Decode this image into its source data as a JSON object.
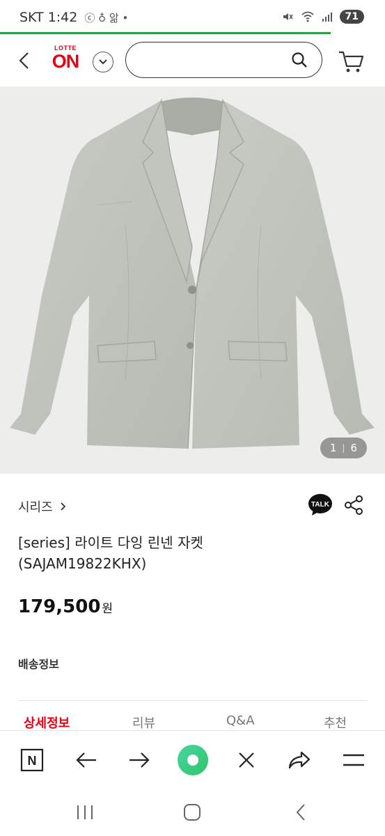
{
  "status_bar": {
    "carrier_time": "SKT 1:42",
    "extra_icons": "ⓒ ♁ 앎 •",
    "battery": "71"
  },
  "header": {
    "logo_top": "LOTTE",
    "logo_main": "ON",
    "search_placeholder": ""
  },
  "gallery": {
    "current": "1",
    "separator": "|",
    "total": "6"
  },
  "product": {
    "brand": "시리즈",
    "title": "[series] 라이트 다잉 린넨 자켓 (SAJAM19822KHX)",
    "price": "179,500",
    "currency": "원",
    "shipping_label": "배송정보"
  },
  "tabs": [
    {
      "label": "상세정보"
    },
    {
      "label": "리뷰"
    },
    {
      "label": "Q&A"
    },
    {
      "label": "추천"
    }
  ],
  "colors": {
    "brand_red": "#e60012",
    "progress_green": "#2e9e3f",
    "browser_home_green": "#2ecc71"
  }
}
